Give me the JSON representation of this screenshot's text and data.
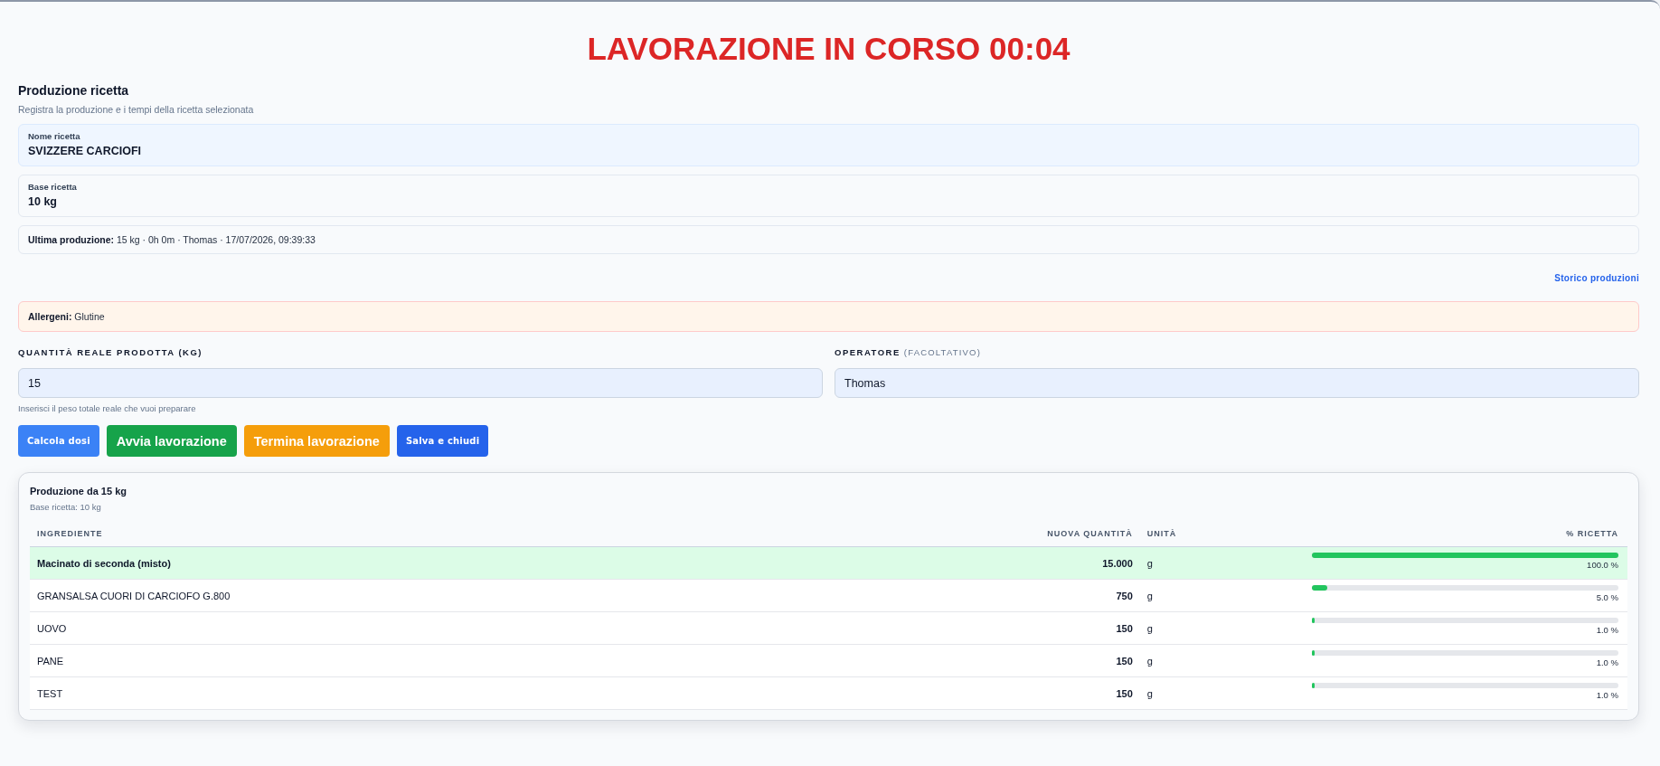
{
  "title": "LAVORAZIONE IN CORSO 00:04",
  "header": {
    "title": "Produzione ricetta",
    "subtitle": "Registra la produzione e i tempi della ricetta selezionata"
  },
  "recipe_fields": [
    {
      "kind": "highlight",
      "label": "Nome ricetta",
      "value": "SVIZZERE CARCIOFI"
    },
    {
      "kind": "plain",
      "label": "Base ricetta",
      "value": "10 kg"
    }
  ],
  "last_production": "**Ultima produzione:** 15 kg · 0h 0m · Thomas · 17/07/2026, 09:39:33",
  "history_link": "Storico produzioni",
  "allergens": "**Allergeni:** Glutine",
  "form": {
    "fields": [
      {
        "label": "QUANTITÀ REALE PRODOTTA (KG)",
        "value": "15",
        "hint": "Inserisci il peso totale reale che vuoi preparare"
      },
      {
        "label": "OPERATORE",
        "note": "(FACOLTATIVO)",
        "value": "Thomas"
      }
    ]
  },
  "buttons": [
    {
      "label": "Calcola dosi",
      "kind": "small",
      "color": "#3b82f6"
    },
    {
      "label": "Avvia lavorazione",
      "kind": "large",
      "color": "#16a34a"
    },
    {
      "label": "Termina lavorazione",
      "kind": "large",
      "color": "#f59e0b"
    },
    {
      "label": "Salva e chiudi",
      "kind": "small",
      "color": "#2563eb"
    }
  ],
  "results": {
    "title": "Produzione da 15 kg",
    "subtitle": "Base ricetta: 10 kg",
    "columns": [
      "INGREDIENTE",
      "NUOVA QUANTITÀ",
      "UNITÀ",
      "% RICETTA"
    ],
    "rows": [
      {
        "ingredient": "Macinato di seconda (misto)",
        "quantity": "15.000",
        "unit": "g",
        "level": 1,
        "percent": "100.0 %",
        "highlighted": true
      },
      {
        "ingredient": "GRANSALSA CUORI DI CARCIOFO G.800",
        "quantity": "750",
        "unit": "g",
        "level": 0.05,
        "percent": "5.0 %",
        "highlighted": false
      },
      {
        "ingredient": "UOVO",
        "quantity": "150",
        "unit": "g",
        "level": 0.01,
        "percent": "1.0 %",
        "highlighted": false
      },
      {
        "ingredient": "PANE",
        "quantity": "150",
        "unit": "g",
        "level": 0.01,
        "percent": "1.0 %",
        "highlighted": false
      },
      {
        "ingredient": "TEST",
        "quantity": "150",
        "unit": "g",
        "level": 0.01,
        "percent": "1.0 %",
        "highlighted": false
      }
    ]
  }
}
